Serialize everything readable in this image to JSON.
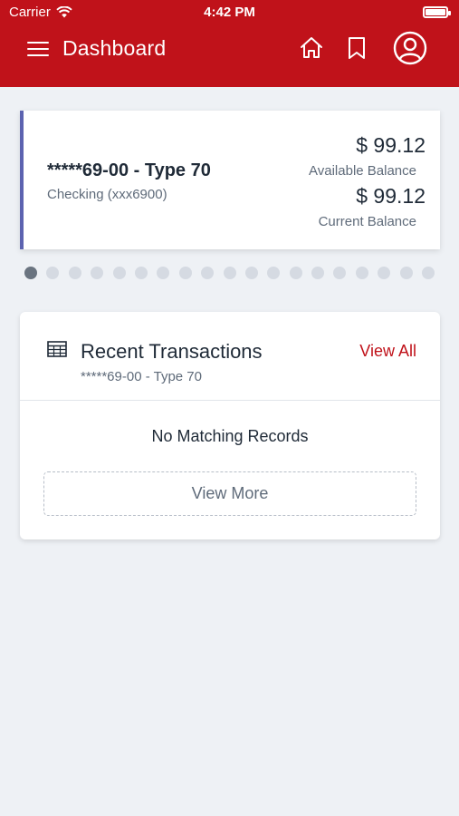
{
  "status_bar": {
    "carrier": "Carrier",
    "time": "4:42 PM"
  },
  "header": {
    "title": "Dashboard",
    "icons": [
      "menu-icon",
      "home-icon",
      "bookmark-icon",
      "profile-icon"
    ],
    "background": "#c0121a"
  },
  "account": {
    "name": "*****69-00 - Type 70",
    "type": "Checking (xxx6900)",
    "available_balance": "$ 99.12",
    "available_label": "Available Balance",
    "current_balance": "$ 99.12",
    "current_label": "Current Balance",
    "accent": "#5c63b0"
  },
  "pager": {
    "total": 19,
    "active_index": 0
  },
  "transactions": {
    "title": "Recent Transactions",
    "subtitle": "*****69-00 - Type 70",
    "view_all": "View All",
    "empty_message": "No Matching Records",
    "view_more": "View More",
    "icon": "table-icon"
  }
}
